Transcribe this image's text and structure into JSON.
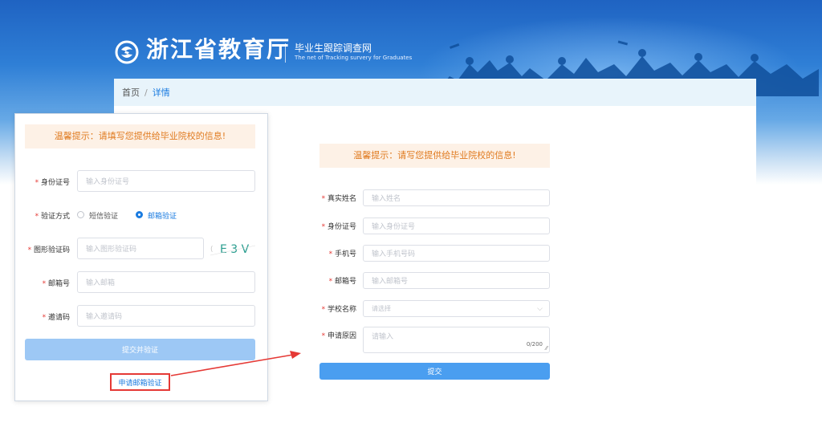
{
  "header": {
    "title": "浙江省教育厅",
    "subtitle": "毕业生跟踪调查网",
    "subtitle_en": "The net of Tracking survery for Graduates"
  },
  "breadcrumb": {
    "home": "首页",
    "separator": "/",
    "current": "详情"
  },
  "left_form": {
    "tip": "温馨提示：请填写您提供给毕业院校的信息!",
    "id_label": "身份证号",
    "id_placeholder": "输入身份证号",
    "verify_label": "验证方式",
    "verify_options": [
      "短信验证",
      "邮箱验证"
    ],
    "selected_verify": "邮箱验证",
    "captcha_label": "图形验证码",
    "captcha_placeholder": "输入图形验证码",
    "captcha_text": "E 3 V",
    "email_label": "邮箱号",
    "email_placeholder": "输入邮箱",
    "invite_label": "邀请码",
    "invite_placeholder": "输入邀请码",
    "submit_label": "提交并验证",
    "apply_link": "申请邮箱验证"
  },
  "right_form": {
    "tip": "温馨提示：请写您提供给毕业院校的信息!",
    "name_label": "真实姓名",
    "name_placeholder": "输入姓名",
    "id_label": "身份证号",
    "id_placeholder": "输入身份证号",
    "phone_label": "手机号",
    "phone_placeholder": "输入手机号码",
    "email_label": "邮箱号",
    "email_placeholder": "输入邮箱号",
    "school_label": "学校名称",
    "school_placeholder": "请选择",
    "reason_label": "申请原因",
    "reason_placeholder": "请输入",
    "reason_counter": "0/200",
    "submit_label": "提交"
  },
  "colors": {
    "primary": "#1a7be0",
    "button": "#4a9ef0",
    "button_disabled": "#9dc8f5",
    "tip_bg": "#fdf1e6",
    "tip_text": "#e07a1f",
    "annotation": "#e53935"
  }
}
